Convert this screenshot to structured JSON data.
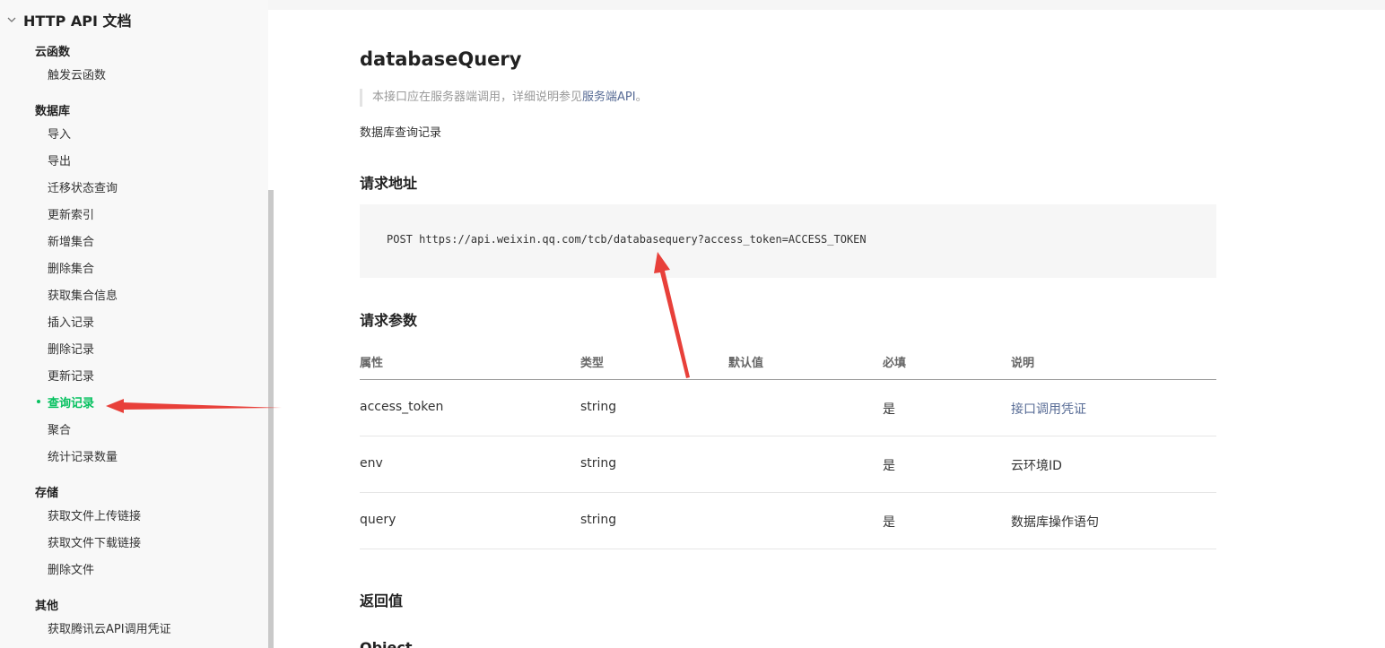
{
  "sidebar": {
    "section_title": "HTTP API 文档",
    "groups": [
      {
        "label": "云函数",
        "items": [
          "触发云函数"
        ]
      },
      {
        "label": "数据库",
        "items": [
          "导入",
          "导出",
          "迁移状态查询",
          "更新索引",
          "新增集合",
          "删除集合",
          "获取集合信息",
          "插入记录",
          "删除记录",
          "更新记录",
          "查询记录",
          "聚合",
          "统计记录数量"
        ]
      },
      {
        "label": "存储",
        "items": [
          "获取文件上传链接",
          "获取文件下载链接",
          "删除文件"
        ]
      },
      {
        "label": "其他",
        "items": [
          "获取腾讯云API调用凭证"
        ]
      }
    ],
    "active_item": "查询记录"
  },
  "main": {
    "title": "databaseQuery",
    "note_prefix": "本接口应在服务器端调用，详细说明参见",
    "note_link": "服务端API",
    "note_suffix": "。",
    "description": "数据库查询记录",
    "request_url_heading": "请求地址",
    "request_url": "POST https://api.weixin.qq.com/tcb/databasequery?access_token=ACCESS_TOKEN",
    "params_heading": "请求参数",
    "table": {
      "headers": [
        "属性",
        "类型",
        "默认值",
        "必填",
        "说明"
      ],
      "rows": [
        [
          "access_token",
          "string",
          "",
          "是",
          "接口调用凭证"
        ],
        [
          "env",
          "string",
          "",
          "是",
          "云环境ID"
        ],
        [
          "query",
          "string",
          "",
          "是",
          "数据库操作语句"
        ]
      ]
    },
    "return_heading": "返回值",
    "next_heading": "Object"
  },
  "colors": {
    "accent": "#07c160",
    "link": "#576b95",
    "annotation_arrow": "#e8403a"
  }
}
